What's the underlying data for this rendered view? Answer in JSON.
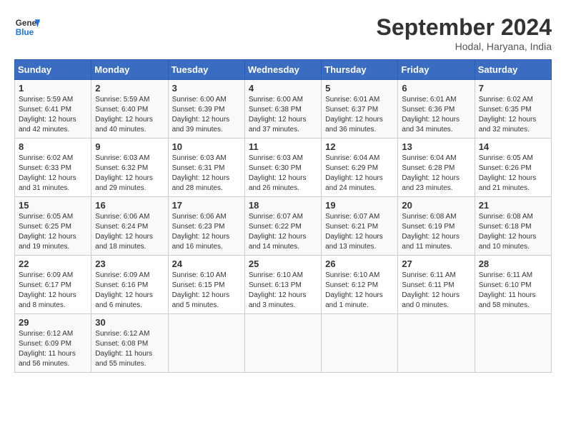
{
  "header": {
    "logo_line1": "General",
    "logo_line2": "Blue",
    "month": "September 2024",
    "location": "Hodal, Haryana, India"
  },
  "days_of_week": [
    "Sunday",
    "Monday",
    "Tuesday",
    "Wednesday",
    "Thursday",
    "Friday",
    "Saturday"
  ],
  "weeks": [
    [
      {
        "day": "1",
        "sunrise": "5:59 AM",
        "sunset": "6:41 PM",
        "daylight": "12 hours and 42 minutes."
      },
      {
        "day": "2",
        "sunrise": "5:59 AM",
        "sunset": "6:40 PM",
        "daylight": "12 hours and 40 minutes."
      },
      {
        "day": "3",
        "sunrise": "6:00 AM",
        "sunset": "6:39 PM",
        "daylight": "12 hours and 39 minutes."
      },
      {
        "day": "4",
        "sunrise": "6:00 AM",
        "sunset": "6:38 PM",
        "daylight": "12 hours and 37 minutes."
      },
      {
        "day": "5",
        "sunrise": "6:01 AM",
        "sunset": "6:37 PM",
        "daylight": "12 hours and 36 minutes."
      },
      {
        "day": "6",
        "sunrise": "6:01 AM",
        "sunset": "6:36 PM",
        "daylight": "12 hours and 34 minutes."
      },
      {
        "day": "7",
        "sunrise": "6:02 AM",
        "sunset": "6:35 PM",
        "daylight": "12 hours and 32 minutes."
      }
    ],
    [
      {
        "day": "8",
        "sunrise": "6:02 AM",
        "sunset": "6:33 PM",
        "daylight": "12 hours and 31 minutes."
      },
      {
        "day": "9",
        "sunrise": "6:03 AM",
        "sunset": "6:32 PM",
        "daylight": "12 hours and 29 minutes."
      },
      {
        "day": "10",
        "sunrise": "6:03 AM",
        "sunset": "6:31 PM",
        "daylight": "12 hours and 28 minutes."
      },
      {
        "day": "11",
        "sunrise": "6:03 AM",
        "sunset": "6:30 PM",
        "daylight": "12 hours and 26 minutes."
      },
      {
        "day": "12",
        "sunrise": "6:04 AM",
        "sunset": "6:29 PM",
        "daylight": "12 hours and 24 minutes."
      },
      {
        "day": "13",
        "sunrise": "6:04 AM",
        "sunset": "6:28 PM",
        "daylight": "12 hours and 23 minutes."
      },
      {
        "day": "14",
        "sunrise": "6:05 AM",
        "sunset": "6:26 PM",
        "daylight": "12 hours and 21 minutes."
      }
    ],
    [
      {
        "day": "15",
        "sunrise": "6:05 AM",
        "sunset": "6:25 PM",
        "daylight": "12 hours and 19 minutes."
      },
      {
        "day": "16",
        "sunrise": "6:06 AM",
        "sunset": "6:24 PM",
        "daylight": "12 hours and 18 minutes."
      },
      {
        "day": "17",
        "sunrise": "6:06 AM",
        "sunset": "6:23 PM",
        "daylight": "12 hours and 16 minutes."
      },
      {
        "day": "18",
        "sunrise": "6:07 AM",
        "sunset": "6:22 PM",
        "daylight": "12 hours and 14 minutes."
      },
      {
        "day": "19",
        "sunrise": "6:07 AM",
        "sunset": "6:21 PM",
        "daylight": "12 hours and 13 minutes."
      },
      {
        "day": "20",
        "sunrise": "6:08 AM",
        "sunset": "6:19 PM",
        "daylight": "12 hours and 11 minutes."
      },
      {
        "day": "21",
        "sunrise": "6:08 AM",
        "sunset": "6:18 PM",
        "daylight": "12 hours and 10 minutes."
      }
    ],
    [
      {
        "day": "22",
        "sunrise": "6:09 AM",
        "sunset": "6:17 PM",
        "daylight": "12 hours and 8 minutes."
      },
      {
        "day": "23",
        "sunrise": "6:09 AM",
        "sunset": "6:16 PM",
        "daylight": "12 hours and 6 minutes."
      },
      {
        "day": "24",
        "sunrise": "6:10 AM",
        "sunset": "6:15 PM",
        "daylight": "12 hours and 5 minutes."
      },
      {
        "day": "25",
        "sunrise": "6:10 AM",
        "sunset": "6:13 PM",
        "daylight": "12 hours and 3 minutes."
      },
      {
        "day": "26",
        "sunrise": "6:10 AM",
        "sunset": "6:12 PM",
        "daylight": "12 hours and 1 minute."
      },
      {
        "day": "27",
        "sunrise": "6:11 AM",
        "sunset": "6:11 PM",
        "daylight": "12 hours and 0 minutes."
      },
      {
        "day": "28",
        "sunrise": "6:11 AM",
        "sunset": "6:10 PM",
        "daylight": "11 hours and 58 minutes."
      }
    ],
    [
      {
        "day": "29",
        "sunrise": "6:12 AM",
        "sunset": "6:09 PM",
        "daylight": "11 hours and 56 minutes."
      },
      {
        "day": "30",
        "sunrise": "6:12 AM",
        "sunset": "6:08 PM",
        "daylight": "11 hours and 55 minutes."
      },
      null,
      null,
      null,
      null,
      null
    ]
  ]
}
